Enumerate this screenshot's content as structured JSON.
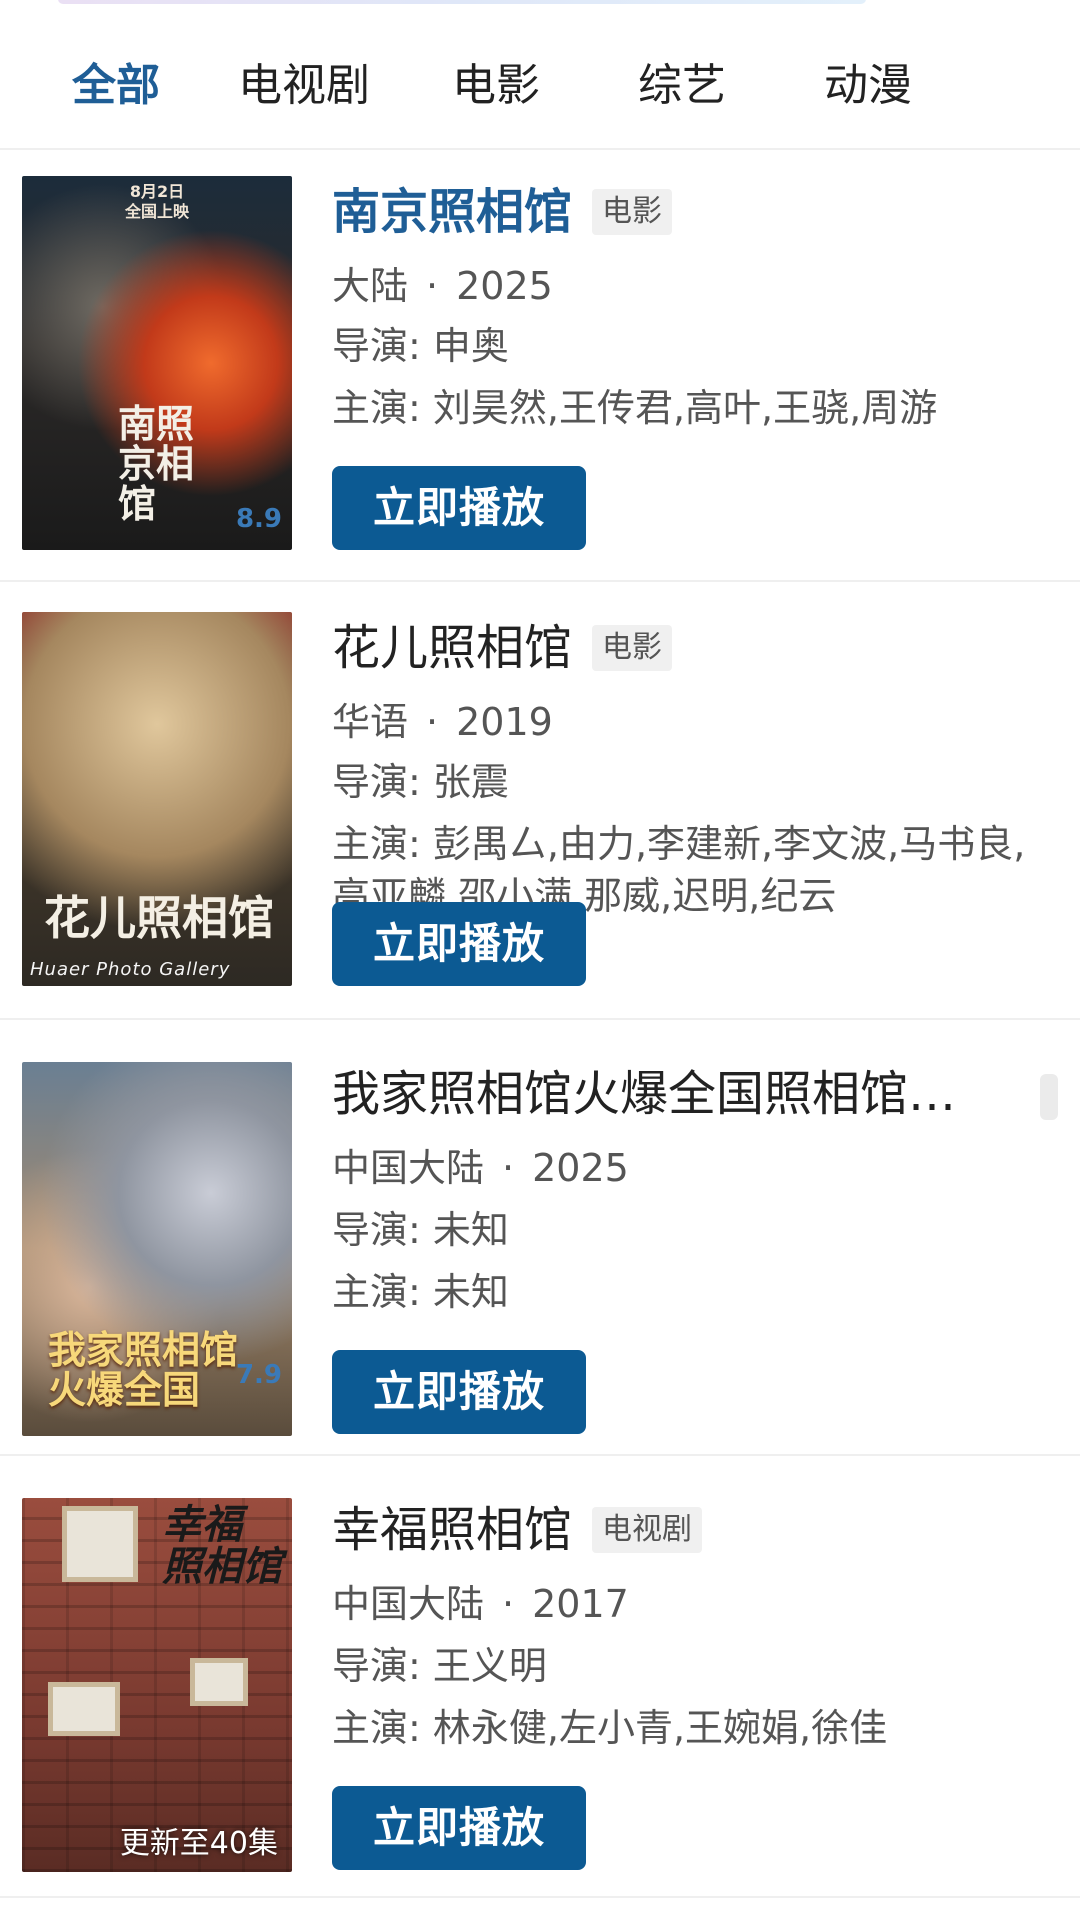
{
  "tabs": [
    {
      "label": "全部",
      "active": true
    },
    {
      "label": "电视剧",
      "active": false
    },
    {
      "label": "电影",
      "active": false
    },
    {
      "label": "综艺",
      "active": false
    },
    {
      "label": "动漫",
      "active": false
    }
  ],
  "results": [
    {
      "title": "南京照相馆",
      "type": "电影",
      "region": "大陆",
      "year": "2025",
      "director": "导演: 申奥",
      "cast": "主演: 刘昊然,王传君,高叶,王骁,周游",
      "play_label": "立即播放",
      "poster": {
        "text": "南照\n京相\n馆",
        "date": "8月2日\n全国上映",
        "score": "8.9"
      }
    },
    {
      "title": "花儿照相馆",
      "type": "电影",
      "region": "华语",
      "year": "2019",
      "director": "导演: 张震",
      "cast": "主演: 彭禺厶,由力,李建新,李文波,马书良,高亚麟,邵小满,那威,迟明,纪云",
      "play_label": "立即播放",
      "poster": {
        "text": "花儿照相馆",
        "sub": "Huaer Photo Gallery"
      }
    },
    {
      "title": "我家照相馆火爆全国照相馆…",
      "type": "",
      "region": "中国大陆",
      "year": "2025",
      "director": "导演: 未知",
      "cast": "主演: 未知",
      "play_label": "立即播放",
      "poster": {
        "text": "我家照相馆\n火爆全国",
        "score": "7.9"
      }
    },
    {
      "title": "幸福照相馆",
      "type": "电视剧",
      "region": "中国大陆",
      "year": "2017",
      "director": "导演: 王义明",
      "cast": "主演: 林永健,左小青,王婉娟,徐佳",
      "play_label": "立即播放",
      "poster": {
        "text": "幸福\n照相馆",
        "tag": "更新至40集"
      }
    }
  ],
  "colors": {
    "accent": "#1f5e96",
    "button": "#0c5a93",
    "text": "#222222",
    "meta": "#555555"
  }
}
